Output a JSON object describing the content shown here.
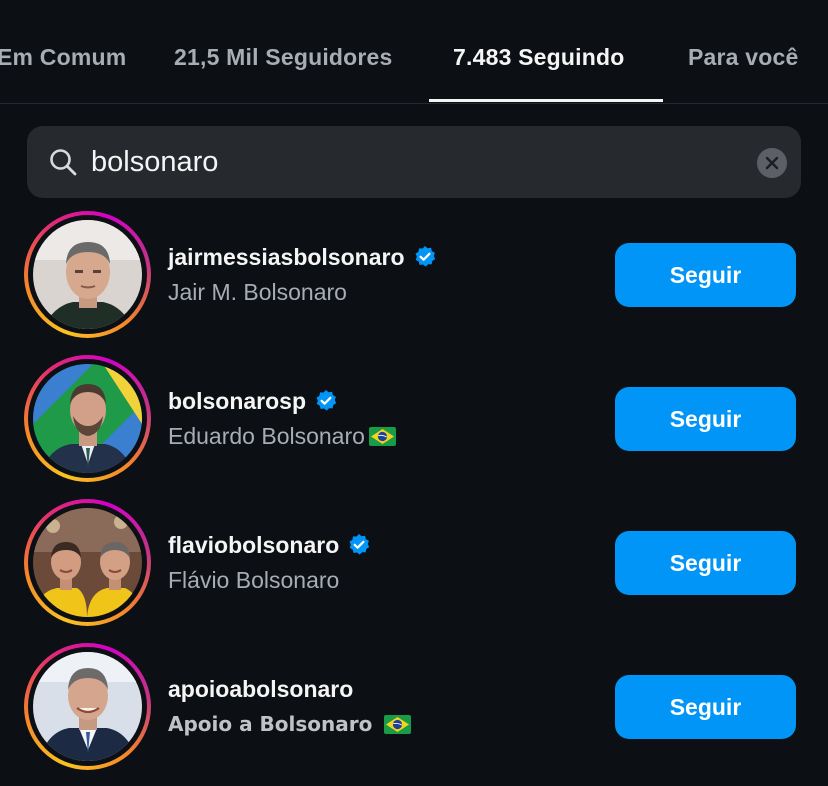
{
  "tabs": [
    {
      "label": "Em Comum",
      "active": false
    },
    {
      "label": "21,5 Mil Seguidores",
      "active": false
    },
    {
      "label": "7.483 Seguindo",
      "active": true
    },
    {
      "label": "Para você",
      "active": false
    }
  ],
  "search": {
    "value": "bolsonaro",
    "icon": "search-icon",
    "clear_icon": "clear-icon"
  },
  "results": [
    {
      "username": "jairmessiasbolsonaro",
      "verified": true,
      "full_name": "Jair M. Bolsonaro",
      "flag": false,
      "button_label": "Seguir"
    },
    {
      "username": "bolsonarosp",
      "verified": true,
      "full_name": "Eduardo Bolsonaro",
      "flag": true,
      "button_label": "Seguir"
    },
    {
      "username": "flaviobolsonaro",
      "verified": true,
      "full_name": "Flávio Bolsonaro",
      "flag": false,
      "button_label": "Seguir"
    },
    {
      "username": "apoioabolsonaro",
      "verified": false,
      "full_name": "Apoio a Bolsonaro",
      "flag": true,
      "button_label": "Seguir"
    }
  ],
  "colors": {
    "background": "#0c0f14",
    "follow_button": "#0095f6",
    "verified_badge": "#0095f6",
    "search_field": "#26292e"
  }
}
